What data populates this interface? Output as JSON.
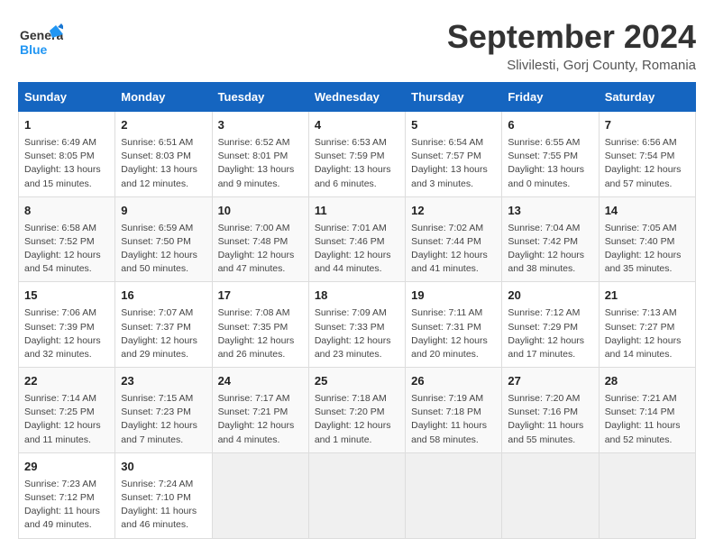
{
  "header": {
    "logo_line1": "General",
    "logo_line2": "Blue",
    "month": "September 2024",
    "location": "Slivilesti, Gorj County, Romania"
  },
  "weekdays": [
    "Sunday",
    "Monday",
    "Tuesday",
    "Wednesday",
    "Thursday",
    "Friday",
    "Saturday"
  ],
  "weeks": [
    [
      {
        "day": 1,
        "lines": [
          "Sunrise: 6:49 AM",
          "Sunset: 8:05 PM",
          "Daylight: 13 hours",
          "and 15 minutes."
        ]
      },
      {
        "day": 2,
        "lines": [
          "Sunrise: 6:51 AM",
          "Sunset: 8:03 PM",
          "Daylight: 13 hours",
          "and 12 minutes."
        ]
      },
      {
        "day": 3,
        "lines": [
          "Sunrise: 6:52 AM",
          "Sunset: 8:01 PM",
          "Daylight: 13 hours",
          "and 9 minutes."
        ]
      },
      {
        "day": 4,
        "lines": [
          "Sunrise: 6:53 AM",
          "Sunset: 7:59 PM",
          "Daylight: 13 hours",
          "and 6 minutes."
        ]
      },
      {
        "day": 5,
        "lines": [
          "Sunrise: 6:54 AM",
          "Sunset: 7:57 PM",
          "Daylight: 13 hours",
          "and 3 minutes."
        ]
      },
      {
        "day": 6,
        "lines": [
          "Sunrise: 6:55 AM",
          "Sunset: 7:55 PM",
          "Daylight: 13 hours",
          "and 0 minutes."
        ]
      },
      {
        "day": 7,
        "lines": [
          "Sunrise: 6:56 AM",
          "Sunset: 7:54 PM",
          "Daylight: 12 hours",
          "and 57 minutes."
        ]
      }
    ],
    [
      {
        "day": 8,
        "lines": [
          "Sunrise: 6:58 AM",
          "Sunset: 7:52 PM",
          "Daylight: 12 hours",
          "and 54 minutes."
        ]
      },
      {
        "day": 9,
        "lines": [
          "Sunrise: 6:59 AM",
          "Sunset: 7:50 PM",
          "Daylight: 12 hours",
          "and 50 minutes."
        ]
      },
      {
        "day": 10,
        "lines": [
          "Sunrise: 7:00 AM",
          "Sunset: 7:48 PM",
          "Daylight: 12 hours",
          "and 47 minutes."
        ]
      },
      {
        "day": 11,
        "lines": [
          "Sunrise: 7:01 AM",
          "Sunset: 7:46 PM",
          "Daylight: 12 hours",
          "and 44 minutes."
        ]
      },
      {
        "day": 12,
        "lines": [
          "Sunrise: 7:02 AM",
          "Sunset: 7:44 PM",
          "Daylight: 12 hours",
          "and 41 minutes."
        ]
      },
      {
        "day": 13,
        "lines": [
          "Sunrise: 7:04 AM",
          "Sunset: 7:42 PM",
          "Daylight: 12 hours",
          "and 38 minutes."
        ]
      },
      {
        "day": 14,
        "lines": [
          "Sunrise: 7:05 AM",
          "Sunset: 7:40 PM",
          "Daylight: 12 hours",
          "and 35 minutes."
        ]
      }
    ],
    [
      {
        "day": 15,
        "lines": [
          "Sunrise: 7:06 AM",
          "Sunset: 7:39 PM",
          "Daylight: 12 hours",
          "and 32 minutes."
        ]
      },
      {
        "day": 16,
        "lines": [
          "Sunrise: 7:07 AM",
          "Sunset: 7:37 PM",
          "Daylight: 12 hours",
          "and 29 minutes."
        ]
      },
      {
        "day": 17,
        "lines": [
          "Sunrise: 7:08 AM",
          "Sunset: 7:35 PM",
          "Daylight: 12 hours",
          "and 26 minutes."
        ]
      },
      {
        "day": 18,
        "lines": [
          "Sunrise: 7:09 AM",
          "Sunset: 7:33 PM",
          "Daylight: 12 hours",
          "and 23 minutes."
        ]
      },
      {
        "day": 19,
        "lines": [
          "Sunrise: 7:11 AM",
          "Sunset: 7:31 PM",
          "Daylight: 12 hours",
          "and 20 minutes."
        ]
      },
      {
        "day": 20,
        "lines": [
          "Sunrise: 7:12 AM",
          "Sunset: 7:29 PM",
          "Daylight: 12 hours",
          "and 17 minutes."
        ]
      },
      {
        "day": 21,
        "lines": [
          "Sunrise: 7:13 AM",
          "Sunset: 7:27 PM",
          "Daylight: 12 hours",
          "and 14 minutes."
        ]
      }
    ],
    [
      {
        "day": 22,
        "lines": [
          "Sunrise: 7:14 AM",
          "Sunset: 7:25 PM",
          "Daylight: 12 hours",
          "and 11 minutes."
        ]
      },
      {
        "day": 23,
        "lines": [
          "Sunrise: 7:15 AM",
          "Sunset: 7:23 PM",
          "Daylight: 12 hours",
          "and 7 minutes."
        ]
      },
      {
        "day": 24,
        "lines": [
          "Sunrise: 7:17 AM",
          "Sunset: 7:21 PM",
          "Daylight: 12 hours",
          "and 4 minutes."
        ]
      },
      {
        "day": 25,
        "lines": [
          "Sunrise: 7:18 AM",
          "Sunset: 7:20 PM",
          "Daylight: 12 hours",
          "and 1 minute."
        ]
      },
      {
        "day": 26,
        "lines": [
          "Sunrise: 7:19 AM",
          "Sunset: 7:18 PM",
          "Daylight: 11 hours",
          "and 58 minutes."
        ]
      },
      {
        "day": 27,
        "lines": [
          "Sunrise: 7:20 AM",
          "Sunset: 7:16 PM",
          "Daylight: 11 hours",
          "and 55 minutes."
        ]
      },
      {
        "day": 28,
        "lines": [
          "Sunrise: 7:21 AM",
          "Sunset: 7:14 PM",
          "Daylight: 11 hours",
          "and 52 minutes."
        ]
      }
    ],
    [
      {
        "day": 29,
        "lines": [
          "Sunrise: 7:23 AM",
          "Sunset: 7:12 PM",
          "Daylight: 11 hours",
          "and 49 minutes."
        ]
      },
      {
        "day": 30,
        "lines": [
          "Sunrise: 7:24 AM",
          "Sunset: 7:10 PM",
          "Daylight: 11 hours",
          "and 46 minutes."
        ]
      },
      null,
      null,
      null,
      null,
      null
    ]
  ]
}
